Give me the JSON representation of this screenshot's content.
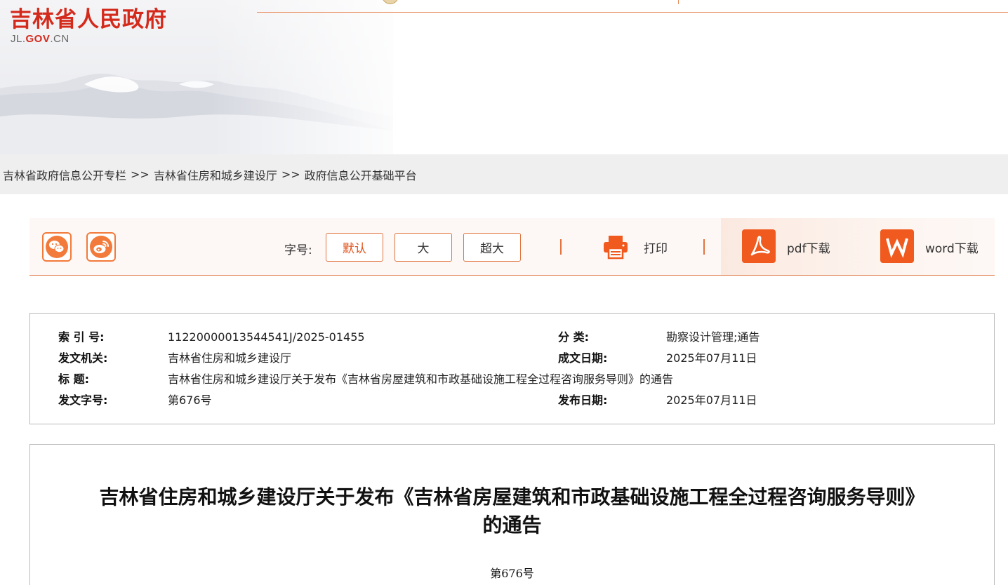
{
  "header": {
    "site_title": "吉林省人民政府",
    "domain_prefix": "JL.",
    "domain_gov": "GOV",
    "domain_suffix": ".CN"
  },
  "breadcrumb": {
    "items": [
      "吉林省政府信息公开专栏",
      "吉林省住房和城乡建设厅",
      "政府信息公开基础平台"
    ],
    "separator": ">>"
  },
  "toolbar": {
    "share_icons": [
      "wechat-icon",
      "weibo-icon"
    ],
    "font_size_label": "字号:",
    "font_sizes": [
      "默认",
      "大",
      "超大"
    ],
    "active_font_size": "默认",
    "print_label": "打印",
    "pdf_label": "pdf下载",
    "word_label": "word下载",
    "accent_color": "#f05a1e"
  },
  "meta": {
    "index_key": "索  引  号:",
    "index_value": "11220000013544541J/2025-01455",
    "category_key": "分      类:",
    "category_value": "勘察设计管理;通告",
    "issuer_key": "发文机关:",
    "issuer_value": "吉林省住房和城乡建设厅",
    "written_date_key": "成文日期:",
    "written_date_value": "2025年07月11日",
    "title_key": "标      题:",
    "title_value": "吉林省住房和城乡建设厅关于发布《吉林省房屋建筑和市政基础设施工程全过程咨询服务导则》的通告",
    "doc_number_key": "发文字号:",
    "doc_number_value": "第676号",
    "publish_date_key": "发布日期:",
    "publish_date_value": "2025年07月11日"
  },
  "article": {
    "title_line1": "吉林省住房和城乡建设厅关于发布《吉林省房屋建筑和市政基础设施工程全过程咨询服务导则》",
    "title_line2": "的通告",
    "doc_number": "第676号"
  }
}
